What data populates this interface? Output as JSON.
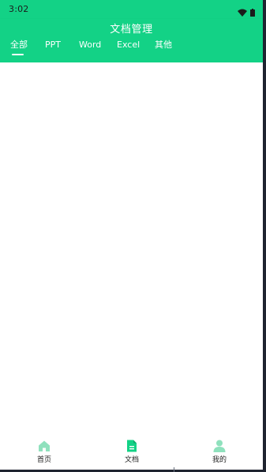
{
  "status_bar": {
    "time": "3:02",
    "icons": [
      "wifi-icon",
      "battery-icon"
    ]
  },
  "header": {
    "title": "文档管理"
  },
  "tabs": [
    {
      "label": "全部",
      "active": true
    },
    {
      "label": "PPT",
      "active": false
    },
    {
      "label": "Word",
      "active": false
    },
    {
      "label": "Excel",
      "active": false
    },
    {
      "label": "其他",
      "active": false
    }
  ],
  "bottom_nav": [
    {
      "label": "首页",
      "icon": "home-icon",
      "active": false
    },
    {
      "label": "文档",
      "icon": "document-icon",
      "active": true
    },
    {
      "label": "我的",
      "icon": "person-icon",
      "active": false
    }
  ],
  "colors": {
    "brand": "#13d286",
    "nav_inactive": "#8fe1bd",
    "nav_active": "#13d286",
    "text_dark": "#222222"
  }
}
